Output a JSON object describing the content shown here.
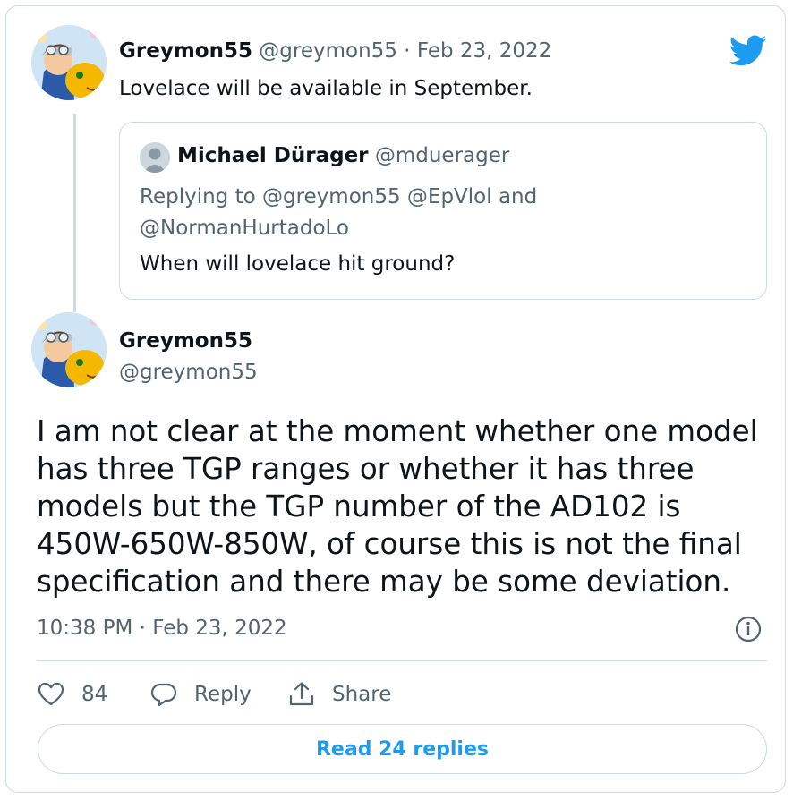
{
  "parent_tweet": {
    "author_name": "Greymon55",
    "author_handle": "@greymon55",
    "date": "Feb 23, 2022",
    "separator": "·",
    "text": "Lovelace will be available in September."
  },
  "quoted_tweet": {
    "author_name": "Michael Dürager",
    "author_handle": "@mduerager",
    "replying_to": "Replying to @greymon55 @EpVlol and @NormanHurtadoLo",
    "text": "When will lovelace hit ground?"
  },
  "main_tweet": {
    "author_name": "Greymon55",
    "author_handle": "@greymon55",
    "text": "I am not clear at the moment whether one model has three TGP ranges or whether it has three models but the TGP number of the AD102 is 450W-650W-850W, of course this is not the final specification and there may be some deviation.",
    "timestamp": "10:38 PM · Feb 23, 2022"
  },
  "actions": {
    "likes": "84",
    "reply_label": "Reply",
    "share_label": "Share"
  },
  "read_replies_label": "Read 24 replies",
  "colors": {
    "accent": "#1d9bf0",
    "muted": "#536471",
    "border": "#cfd9de"
  },
  "icons": [
    "twitter-bird-icon",
    "heart-icon",
    "reply-icon",
    "share-icon",
    "info-icon"
  ]
}
